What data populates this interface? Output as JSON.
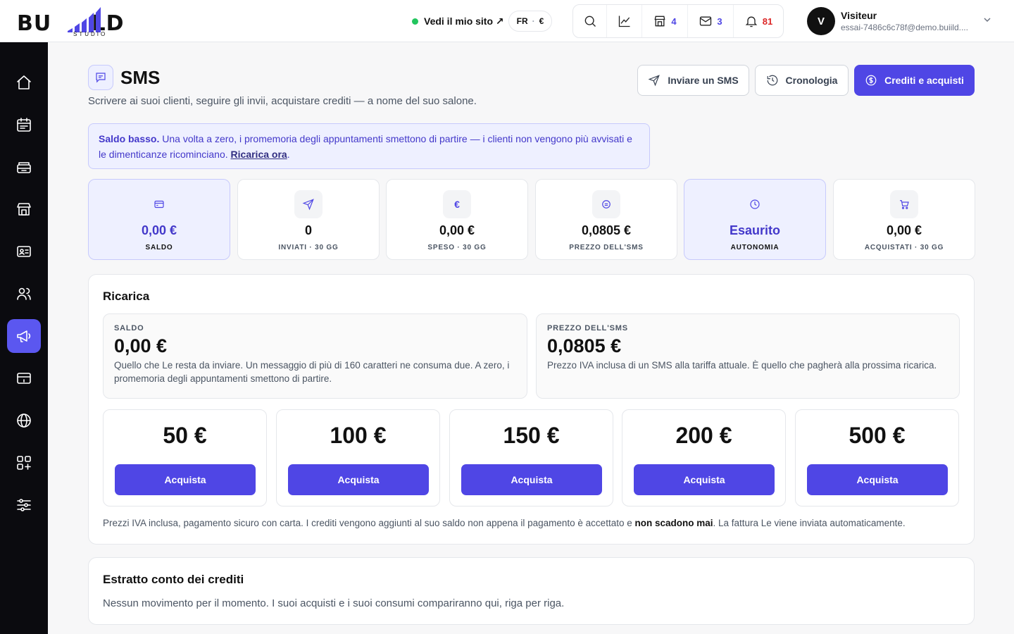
{
  "brand": {
    "logo_word": "BUILD",
    "logo_sub": "STUDIO"
  },
  "topbar": {
    "site_link": "Vedi il mio sito ↗",
    "lang": "FR",
    "currency": "€",
    "counters": {
      "shop": "4",
      "mail": "3",
      "notifications": "81"
    }
  },
  "user": {
    "initial": "V",
    "name": "Visiteur",
    "email": "essai-7486c6c78f@demo.buiild...."
  },
  "page": {
    "title": "SMS",
    "subtitle": "Scrivere ai suoi clienti, seguire gli invii, acquistare crediti — a nome del suo salone."
  },
  "actions": {
    "send": "Inviare un SMS",
    "history": "Cronologia",
    "credits": "Crediti e acquisti"
  },
  "alert": {
    "bold": "Saldo basso.",
    "text": " Una volta a zero, i promemoria degli appuntamenti smettono di partire — i clienti non vengono più avvisati e le dimenticanze ricominciano. ",
    "link": "Ricarica ora",
    "end": "."
  },
  "stats": [
    {
      "value": "0,00 €",
      "label": "SALDO",
      "icon": "card-icon"
    },
    {
      "value": "0",
      "label": "INVIATI · 30 GG",
      "icon": "send-icon"
    },
    {
      "value": "0,00 €",
      "label": "SPESO · 30 GG",
      "icon": "€"
    },
    {
      "value": "0,0805 €",
      "label": "PREZZO DELL'SMS",
      "icon": "tag-icon"
    },
    {
      "value": "Esaurito",
      "label": "AUTONOMIA",
      "icon": "clock-icon"
    },
    {
      "value": "0,00 €",
      "label": "ACQUISTATI · 30 GG",
      "icon": "cart-icon"
    }
  ],
  "recharge": {
    "title": "Ricarica",
    "balance": {
      "label": "SALDO",
      "value": "0,00 €",
      "desc": "Quello che Le resta da inviare. Un messaggio di più di 160 caratteri ne consuma due. A zero, i promemoria degli appuntamenti smettono di partire."
    },
    "price": {
      "label": "PREZZO DELL'SMS",
      "value": "0,0805 €",
      "desc": "Prezzo IVA inclusa di un SMS alla tariffa attuale. È quello che pagherà alla prossima ricarica."
    },
    "packs": [
      {
        "amount": "50 €",
        "button": "Acquista"
      },
      {
        "amount": "100 €",
        "button": "Acquista"
      },
      {
        "amount": "150 €",
        "button": "Acquista"
      },
      {
        "amount": "200 €",
        "button": "Acquista"
      },
      {
        "amount": "500 €",
        "button": "Acquista"
      }
    ],
    "note_a": "Prezzi IVA inclusa, pagamento sicuro con carta. I crediti vengono aggiunti al suo saldo non appena il pagamento è accettato e ",
    "note_b": "non scadono mai",
    "note_c": ". La fattura Le viene inviata automaticamente."
  },
  "statement": {
    "title": "Estratto conto dei crediti",
    "empty": "Nessun movimento per il momento. I suoi acquisti e i suoi consumi compariranno qui, riga per riga."
  },
  "colors": {
    "accent": "#4f46e5",
    "sidebar": "#0b0b0f",
    "active": "#5b57f0",
    "status_online": "#22c55e",
    "badge_red": "#dc2626"
  }
}
